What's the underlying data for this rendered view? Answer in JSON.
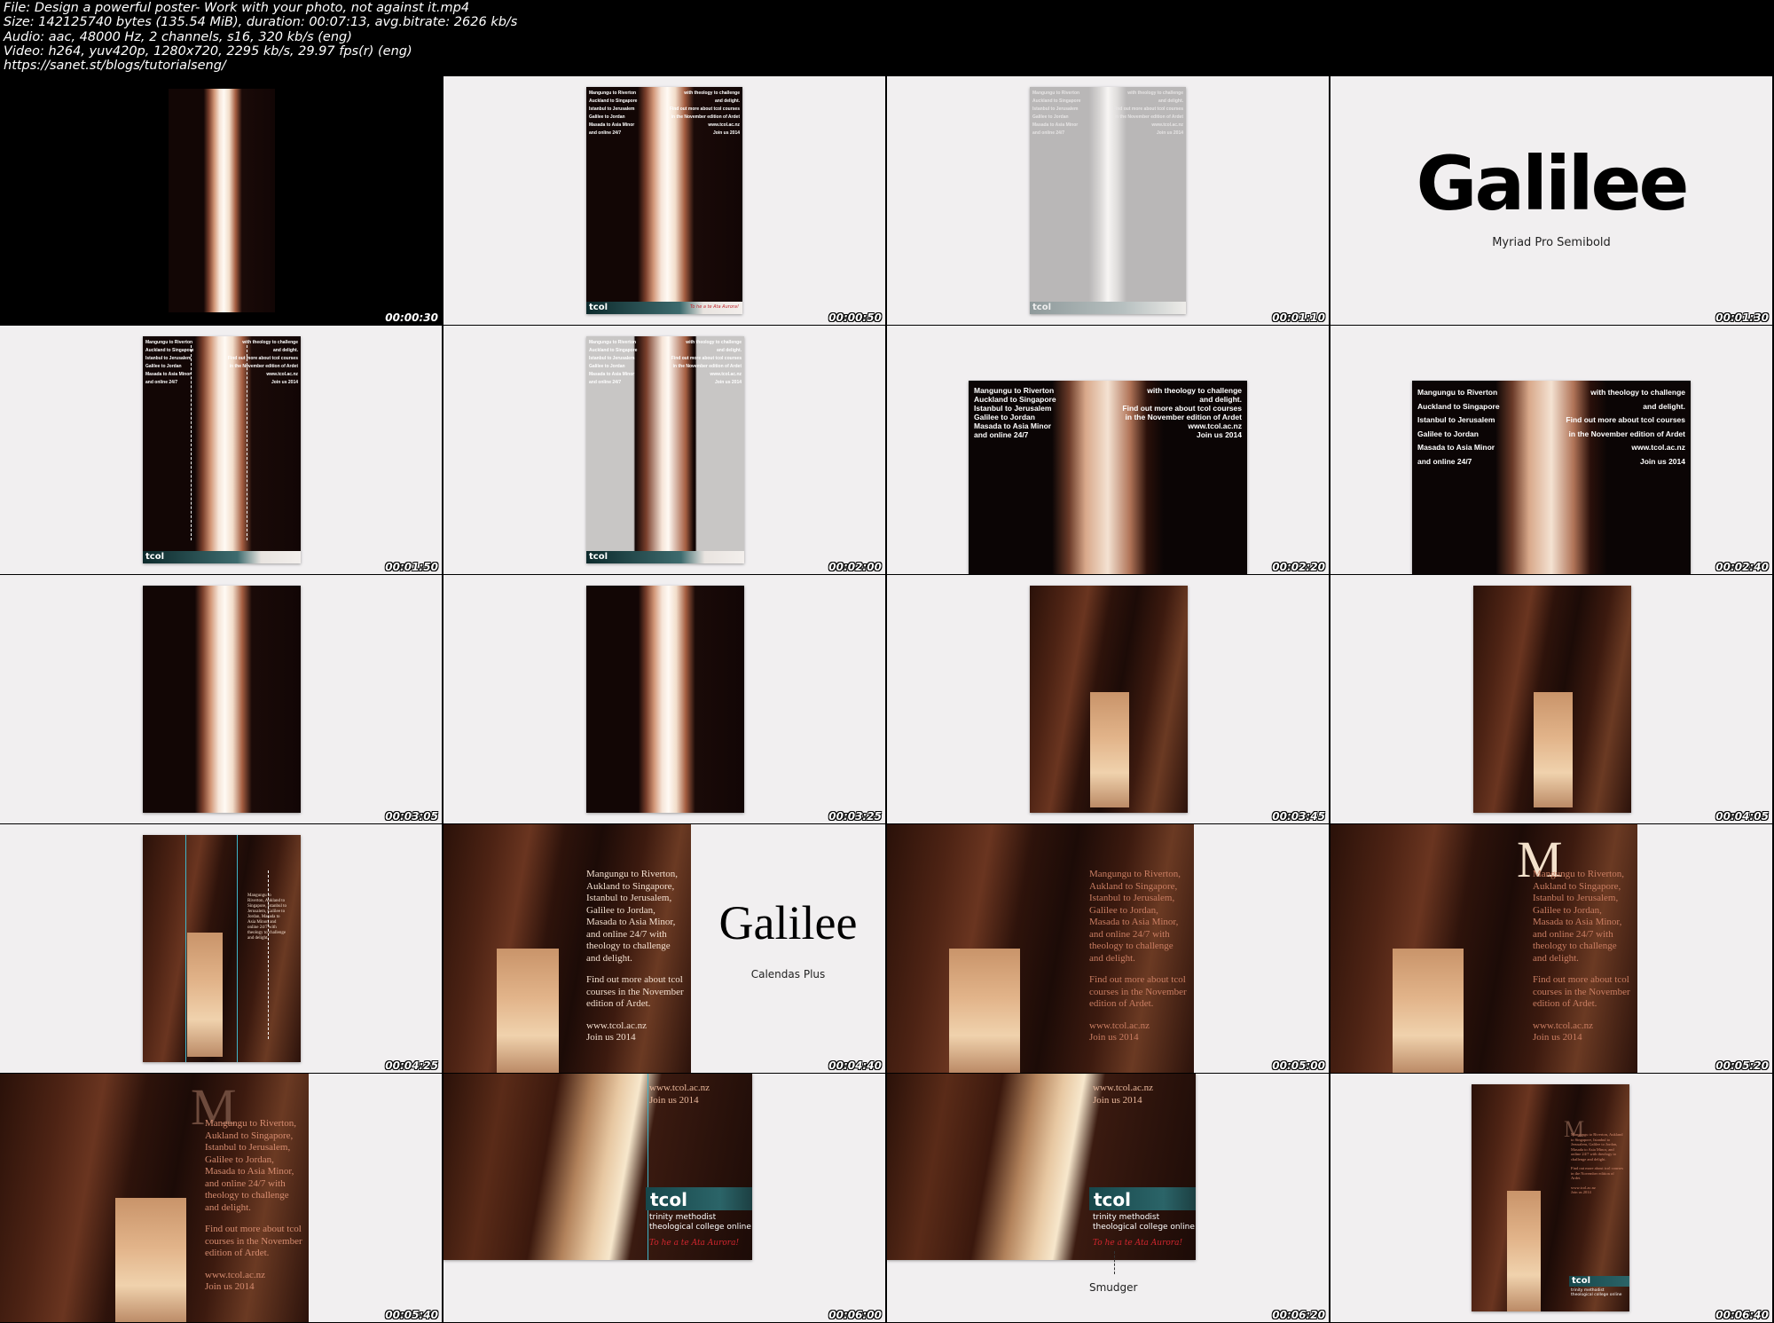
{
  "header": {
    "line1": "File: Design a powerful poster- Work with your photo, not against it.mp4",
    "line2": "Size: 142125740 bytes (135.54 MiB), duration: 00:07:13, avg.bitrate: 2626 kb/s",
    "line3": "Audio: aac, 48000 Hz, 2 channels, s16, 320 kb/s (eng)",
    "line4": "Video: h264, yuv420p, 1280x720, 2295 kb/s, 29.97 fps(r) (eng)",
    "line5": "https://sanet.st/blogs/tutorialseng/"
  },
  "timestamps": [
    "00:00:30",
    "00:00:50",
    "00:01:10",
    "00:01:30",
    "00:01:50",
    "00:02:00",
    "00:02:20",
    "00:02:40",
    "00:03:05",
    "00:03:25",
    "00:03:45",
    "00:04:05",
    "00:04:25",
    "00:04:40",
    "00:05:00",
    "00:05:20",
    "00:05:40",
    "00:06:00",
    "00:06:20",
    "00:06:40"
  ],
  "poster_text": {
    "left_lines": [
      "Mangungu to Riverton",
      "Auckland to Singapore",
      "Istanbul to Jerusalem",
      "Galilee to Jordan",
      "Masada to Asia Minor",
      "and online 24/7"
    ],
    "right_lines": [
      "with theology to challenge",
      "and delight.",
      "Find out more about tcol courses",
      "in the November edition of Ardet",
      "www.tcol.ac.nz",
      "Join us 2014"
    ],
    "serif_block_1": "Mangungu to Riverton, Aukland to Singapore, Istanbul to Jerusalem, Galilee to Jordan, Masada to Asia Minor, and online 24/7 with theology to challenge and delight.",
    "serif_block_2": "Find out more about tcol courses in the November edition of Ardet.",
    "serif_url": "www.tcol.ac.nz",
    "serif_join": "Join us 2014",
    "drop_cap": "M",
    "logo": "tcol",
    "college_line1": "trinity methodist",
    "college_line2": "theological college online",
    "tagline": "To he a te Ata Aurora!"
  },
  "font_samples": {
    "sample1_word": "Galilee",
    "sample1_font": "Myriad Pro Semibold",
    "sample2_word": "Galilee",
    "sample2_font": "Calendas Plus",
    "smudger_label": "Smudger"
  }
}
